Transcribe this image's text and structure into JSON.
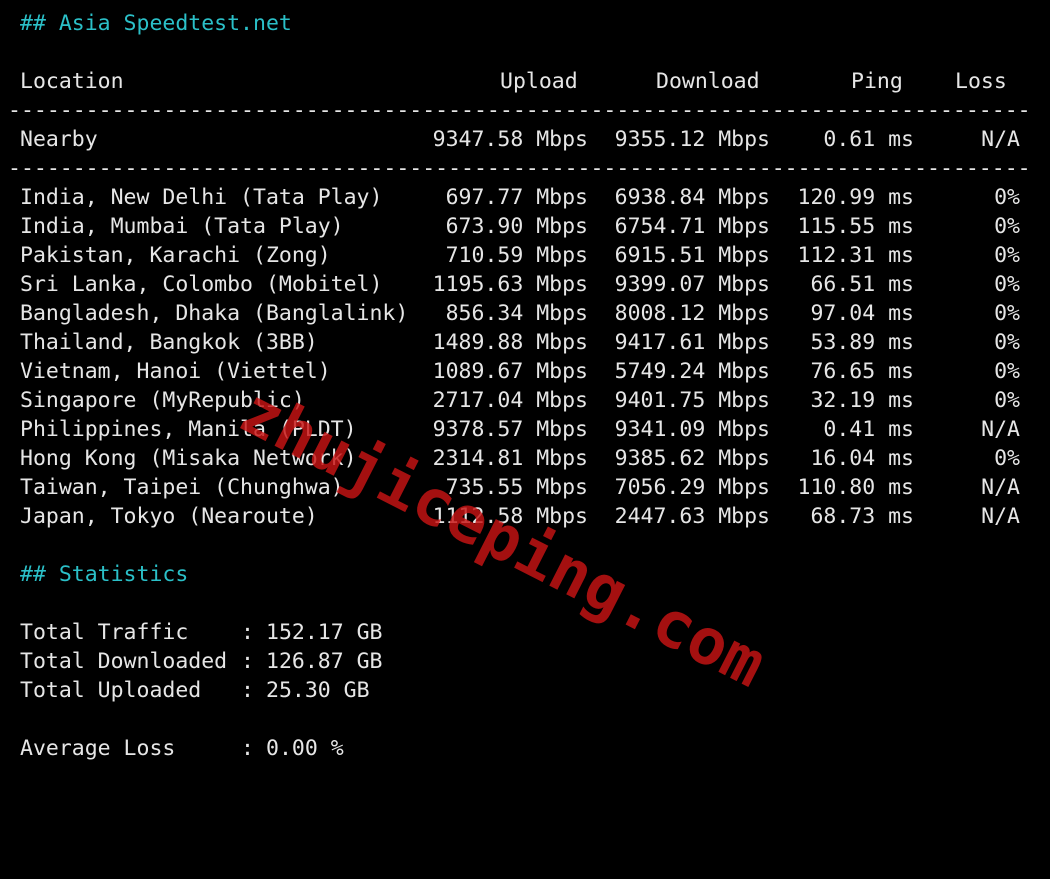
{
  "asia_heading": "## Asia Speedtest.net",
  "columns": {
    "location": "Location",
    "upload": "Upload",
    "download": "Download",
    "ping": "Ping",
    "loss": "Loss"
  },
  "divider": "----------------------------------------------------------------------------------------------------------",
  "nearby": {
    "location": "Nearby",
    "upload": "9347.58 Mbps",
    "download": "9355.12 Mbps",
    "ping": "0.61 ms",
    "loss": "N/A"
  },
  "rows": [
    {
      "location": "India, New Delhi (Tata Play)",
      "upload": "697.77 Mbps",
      "download": "6938.84 Mbps",
      "ping": "120.99 ms",
      "loss": "0%"
    },
    {
      "location": "India, Mumbai (Tata Play)",
      "upload": "673.90 Mbps",
      "download": "6754.71 Mbps",
      "ping": "115.55 ms",
      "loss": "0%"
    },
    {
      "location": "Pakistan, Karachi (Zong)",
      "upload": "710.59 Mbps",
      "download": "6915.51 Mbps",
      "ping": "112.31 ms",
      "loss": "0%"
    },
    {
      "location": "Sri Lanka, Colombo (Mobitel)",
      "upload": "1195.63 Mbps",
      "download": "9399.07 Mbps",
      "ping": "66.51 ms",
      "loss": "0%"
    },
    {
      "location": "Bangladesh, Dhaka (Banglalink)",
      "upload": "856.34 Mbps",
      "download": "8008.12 Mbps",
      "ping": "97.04 ms",
      "loss": "0%"
    },
    {
      "location": "Thailand, Bangkok (3BB)",
      "upload": "1489.88 Mbps",
      "download": "9417.61 Mbps",
      "ping": "53.89 ms",
      "loss": "0%"
    },
    {
      "location": "Vietnam, Hanoi (Viettel)",
      "upload": "1089.67 Mbps",
      "download": "5749.24 Mbps",
      "ping": "76.65 ms",
      "loss": "0%"
    },
    {
      "location": "Singapore (MyRepublic)",
      "upload": "2717.04 Mbps",
      "download": "9401.75 Mbps",
      "ping": "32.19 ms",
      "loss": "0%"
    },
    {
      "location": "Philippines, Manila (PLDT)",
      "upload": "9378.57 Mbps",
      "download": "9341.09 Mbps",
      "ping": "0.41 ms",
      "loss": "N/A"
    },
    {
      "location": "Hong Kong (Misaka Network)",
      "upload": "2314.81 Mbps",
      "download": "9385.62 Mbps",
      "ping": "16.04 ms",
      "loss": "0%"
    },
    {
      "location": "Taiwan, Taipei (Chunghwa)",
      "upload": "735.55 Mbps",
      "download": "7056.29 Mbps",
      "ping": "110.80 ms",
      "loss": "N/A"
    },
    {
      "location": "Japan, Tokyo (Nearoute)",
      "upload": "1112.58 Mbps",
      "download": "2447.63 Mbps",
      "ping": "68.73 ms",
      "loss": "N/A"
    }
  ],
  "statistics_heading": "## Statistics",
  "stats": [
    {
      "key": "Total Traffic",
      "sep": ":",
      "value": "152.17 GB"
    },
    {
      "key": "Total Downloaded",
      "sep": ":",
      "value": "126.87 GB"
    },
    {
      "key": "Total Uploaded",
      "sep": ":",
      "value": "25.30 GB"
    }
  ],
  "average_loss": {
    "key": "Average Loss",
    "sep": ":",
    "value": "0.00 %"
  },
  "watermark": "zhujiceping.com",
  "colors": {
    "background": "#000000",
    "text": "#e6e6e6",
    "heading": "#2bc0c8",
    "watermark": "#c81414"
  }
}
